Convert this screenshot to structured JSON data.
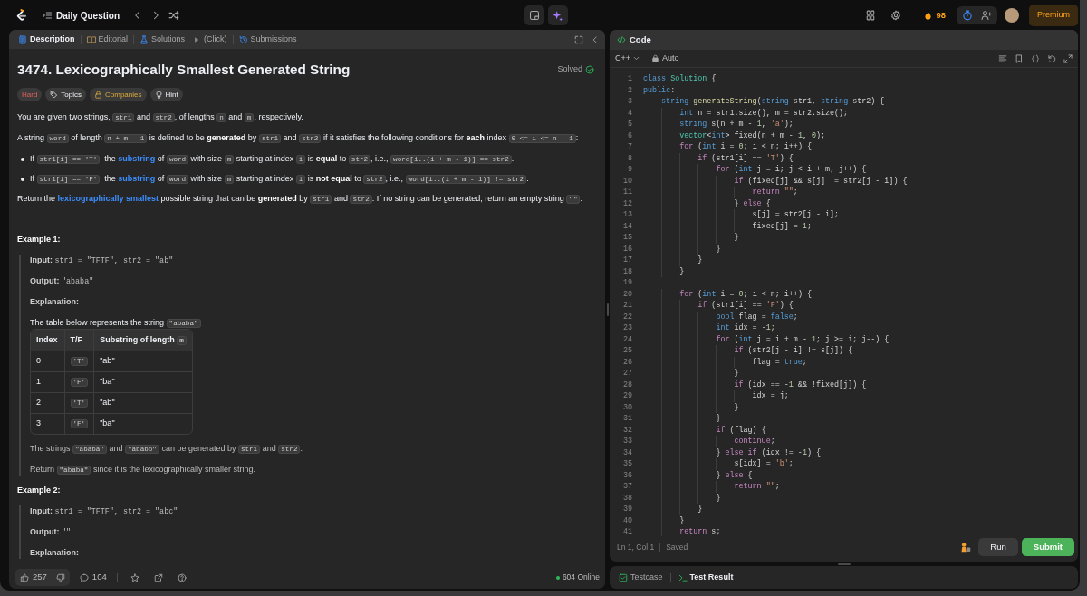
{
  "top_bar": {
    "title": "Daily Question",
    "streak": "98",
    "premium": "Premium"
  },
  "description_panel": {
    "tabs": [
      {
        "label": "Description",
        "selected": true
      },
      {
        "label": "Editorial",
        "selected": false
      },
      {
        "label": "Solutions",
        "selected": false
      },
      {
        "label": "(Click)",
        "selected": false
      },
      {
        "label": "Submissions",
        "selected": false
      }
    ],
    "title": "3474. Lexicographically Smallest Generated String",
    "status": "Solved",
    "tags": [
      {
        "label": "Hard",
        "kind": "difficulty"
      },
      {
        "label": "Topics",
        "kind": "topics"
      },
      {
        "label": "Companies",
        "kind": "companies"
      },
      {
        "label": "Hint",
        "kind": "hint"
      }
    ],
    "statement": [
      {
        "kind": "paragraph",
        "segments": [
          {
            "text": "You are given two strings, "
          },
          {
            "code": "str1"
          },
          {
            "text": " and "
          },
          {
            "code": "str2"
          },
          {
            "text": ", of lengths "
          },
          {
            "code": "n"
          },
          {
            "text": " and "
          },
          {
            "code": "m"
          },
          {
            "text": ", respectively."
          }
        ]
      },
      {
        "kind": "paragraph",
        "segments": [
          {
            "text": "A string "
          },
          {
            "code": "word"
          },
          {
            "text": " of length "
          },
          {
            "code": "n + m - 1"
          },
          {
            "text": " is defined to be **generated** by "
          },
          {
            "code": "str1"
          },
          {
            "text": " and "
          },
          {
            "code": "str2"
          },
          {
            "text": " if it satisfies the following conditions for **each** index "
          },
          {
            "code": "0 <= i <= n - 1"
          },
          {
            "text": ":"
          }
        ]
      },
      {
        "kind": "bullet",
        "segments": [
          {
            "text": "If "
          },
          {
            "code": "str1[i] == 'T'"
          },
          {
            "text": ", the "
          },
          {
            "link": "substring"
          },
          {
            "text": " of "
          },
          {
            "code": "word"
          },
          {
            "text": " with size "
          },
          {
            "code": "m"
          },
          {
            "text": " starting at index "
          },
          {
            "code": "i"
          },
          {
            "text": " is **equal** to "
          },
          {
            "code": "str2"
          },
          {
            "text": ", i.e., "
          },
          {
            "code": "word[i..(i + m - 1)] == str2"
          },
          {
            "text": "."
          }
        ]
      },
      {
        "kind": "bullet",
        "segments": [
          {
            "text": "If "
          },
          {
            "code": "str1[i] == 'F'"
          },
          {
            "text": ", the "
          },
          {
            "link": "substring"
          },
          {
            "text": " of "
          },
          {
            "code": "word"
          },
          {
            "text": " with size "
          },
          {
            "code": "m"
          },
          {
            "text": " starting at index "
          },
          {
            "code": "i"
          },
          {
            "text": " is **not equal** to "
          },
          {
            "code": "str2"
          },
          {
            "text": ", i.e., "
          },
          {
            "code": "word[i..(i + m - 1)] != str2"
          },
          {
            "text": "."
          }
        ]
      },
      {
        "kind": "paragraph",
        "segments": [
          {
            "text": "Return the "
          },
          {
            "link": "lexicographically smallest"
          },
          {
            "text": " possible string that can be **generated** by "
          },
          {
            "code": "str1"
          },
          {
            "text": " and "
          },
          {
            "code": "str2"
          },
          {
            "text": ". If no string can be generated, return an empty string "
          },
          {
            "code": "\"\""
          },
          {
            "text": "."
          }
        ]
      }
    ],
    "examples": [
      {
        "heading": "Example 1:",
        "items": [
          {
            "kind": "io",
            "label": "Input:",
            "value": "str1 = \"TFTF\", str2 = \"ab\""
          },
          {
            "kind": "io",
            "label": "Output:",
            "value": "\"ababa\""
          },
          {
            "kind": "label",
            "label": "Explanation:"
          },
          {
            "kind": "paragraph",
            "segments": [
              {
                "text": "The table below represents the string "
              },
              {
                "code": "\"ababa\""
              }
            ]
          },
          {
            "kind": "table",
            "columns": [
              {
                "segments": [
                  {
                    "text": "Index"
                  }
                ],
                "kind": "text"
              },
              {
                "segments": [
                  {
                    "text": "T/F"
                  }
                ],
                "kind": "code"
              },
              {
                "segments": [
                  {
                    "text": "Substring of length "
                  },
                  {
                    "code": "m"
                  }
                ],
                "kind": "text"
              }
            ],
            "rows": [
              [
                "0",
                "'T'",
                "\"ab\""
              ],
              [
                "1",
                "'F'",
                "\"ba\""
              ],
              [
                "2",
                "'T'",
                "\"ab\""
              ],
              [
                "3",
                "'F'",
                "\"ba\""
              ]
            ]
          },
          {
            "kind": "note",
            "segments": [
              {
                "text": "The strings "
              },
              {
                "code": "\"ababa\""
              },
              {
                "text": " and "
              },
              {
                "code": "\"ababb\""
              },
              {
                "text": " can be generated by "
              },
              {
                "code": "str1"
              },
              {
                "text": " and "
              },
              {
                "code": "str2"
              },
              {
                "text": "."
              }
            ]
          },
          {
            "kind": "note",
            "segments": [
              {
                "text": "Return "
              },
              {
                "code": "\"ababa\""
              },
              {
                "text": " since it is the lexicographically smaller string."
              }
            ]
          }
        ]
      },
      {
        "heading": "Example 2:",
        "items": [
          {
            "kind": "io",
            "label": "Input:",
            "value": "str1 = \"TFTF\", str2 = \"abc\""
          },
          {
            "kind": "io",
            "label": "Output:",
            "value": "\"\""
          },
          {
            "kind": "label",
            "label": "Explanation:"
          }
        ]
      }
    ],
    "footer": {
      "likes": "257",
      "comments": "104",
      "online": "604 Online"
    }
  },
  "editor": {
    "title": "Code",
    "language": "C++",
    "mode": "Auto",
    "lines": [
      {
        "number": "1",
        "tokens": [
          {
            "kind": "keyword",
            "text": "class"
          },
          {
            "kind": "type",
            "text": " Solution"
          },
          {
            "kind": "plain",
            "text": " {"
          }
        ]
      },
      {
        "number": "2",
        "tokens": [
          {
            "kind": "keyword",
            "text": "public"
          },
          {
            "kind": "plain",
            "text": ":"
          }
        ]
      },
      {
        "number": "3",
        "tokens": [
          {
            "kind": "keyword",
            "text": "    string"
          },
          {
            "kind": "function",
            "text": " generateString"
          },
          {
            "kind": "plain",
            "text": "("
          },
          {
            "kind": "keyword",
            "text": "string"
          },
          {
            "kind": "plain",
            "text": " str1, "
          },
          {
            "kind": "keyword",
            "text": "string"
          },
          {
            "kind": "plain",
            "text": " str2) {"
          }
        ]
      },
      {
        "number": "4",
        "tokens": [
          {
            "kind": "keyword",
            "text": "        int"
          },
          {
            "kind": "plain",
            "text": " n = str1.size(), m = str2.size();"
          }
        ]
      },
      {
        "number": "5",
        "tokens": [
          {
            "kind": "keyword",
            "text": "        string"
          },
          {
            "kind": "plain",
            "text": " s(n + m - "
          },
          {
            "kind": "number",
            "text": "1"
          },
          {
            "kind": "plain",
            "text": ", "
          },
          {
            "kind": "string",
            "text": "'a'"
          },
          {
            "kind": "plain",
            "text": ");"
          }
        ]
      },
      {
        "number": "6",
        "tokens": [
          {
            "kind": "type",
            "text": "        vector"
          },
          {
            "kind": "plain",
            "text": "<"
          },
          {
            "kind": "keyword",
            "text": "int"
          },
          {
            "kind": "plain",
            "text": "> fixed(n + m - "
          },
          {
            "kind": "number",
            "text": "1"
          },
          {
            "kind": "plain",
            "text": ", "
          },
          {
            "kind": "number",
            "text": "0"
          },
          {
            "kind": "plain",
            "text": ");"
          }
        ]
      },
      {
        "number": "7",
        "tokens": [
          {
            "kind": "control",
            "text": "        for"
          },
          {
            "kind": "plain",
            "text": " ("
          },
          {
            "kind": "keyword",
            "text": "int"
          },
          {
            "kind": "plain",
            "text": " i = "
          },
          {
            "kind": "number",
            "text": "0"
          },
          {
            "kind": "plain",
            "text": "; i < n; i++) {"
          }
        ]
      },
      {
        "number": "8",
        "tokens": [
          {
            "kind": "control",
            "text": "            if"
          },
          {
            "kind": "plain",
            "text": " (str1[i] == "
          },
          {
            "kind": "string",
            "text": "'T'"
          },
          {
            "kind": "plain",
            "text": ") {"
          }
        ]
      },
      {
        "number": "9",
        "tokens": [
          {
            "kind": "control",
            "text": "                for"
          },
          {
            "kind": "plain",
            "text": " ("
          },
          {
            "kind": "keyword",
            "text": "int"
          },
          {
            "kind": "plain",
            "text": " j = i; j < i + m; j++) {"
          }
        ]
      },
      {
        "number": "10",
        "tokens": [
          {
            "kind": "control",
            "text": "                    if"
          },
          {
            "kind": "plain",
            "text": " (fixed[j] && s[j] != str2[j - i]) {"
          }
        ]
      },
      {
        "number": "11",
        "tokens": [
          {
            "kind": "control",
            "text": "                        return"
          },
          {
            "kind": "string",
            "text": " \"\""
          },
          {
            "kind": "plain",
            "text": ";"
          }
        ]
      },
      {
        "number": "12",
        "tokens": [
          {
            "kind": "plain",
            "text": "                    } "
          },
          {
            "kind": "control",
            "text": "else"
          },
          {
            "kind": "plain",
            "text": " {"
          }
        ]
      },
      {
        "number": "13",
        "tokens": [
          {
            "kind": "plain",
            "text": "                        s[j] = str2[j - i];"
          }
        ]
      },
      {
        "number": "14",
        "tokens": [
          {
            "kind": "plain",
            "text": "                        fixed[j] = "
          },
          {
            "kind": "number",
            "text": "1"
          },
          {
            "kind": "plain",
            "text": ";"
          }
        ]
      },
      {
        "number": "15",
        "tokens": [
          {
            "kind": "plain",
            "text": "                    }"
          }
        ]
      },
      {
        "number": "16",
        "tokens": [
          {
            "kind": "plain",
            "text": "                }"
          }
        ]
      },
      {
        "number": "17",
        "tokens": [
          {
            "kind": "plain",
            "text": "            }"
          }
        ]
      },
      {
        "number": "18",
        "tokens": [
          {
            "kind": "plain",
            "text": "        }"
          }
        ]
      },
      {
        "number": "19"
      },
      {
        "number": "20",
        "tokens": [
          {
            "kind": "control",
            "text": "        for"
          },
          {
            "kind": "plain",
            "text": " ("
          },
          {
            "kind": "keyword",
            "text": "int"
          },
          {
            "kind": "plain",
            "text": " i = "
          },
          {
            "kind": "number",
            "text": "0"
          },
          {
            "kind": "plain",
            "text": "; i < n; i++) {"
          }
        ]
      },
      {
        "number": "21",
        "tokens": [
          {
            "kind": "control",
            "text": "            if"
          },
          {
            "kind": "plain",
            "text": " (str1[i] == "
          },
          {
            "kind": "string",
            "text": "'F'"
          },
          {
            "kind": "plain",
            "text": ") {"
          }
        ]
      },
      {
        "number": "22",
        "tokens": [
          {
            "kind": "keyword",
            "text": "                bool"
          },
          {
            "kind": "plain",
            "text": " flag = "
          },
          {
            "kind": "keyword",
            "text": "false"
          },
          {
            "kind": "plain",
            "text": ";"
          }
        ]
      },
      {
        "number": "23",
        "tokens": [
          {
            "kind": "keyword",
            "text": "                int"
          },
          {
            "kind": "plain",
            "text": " idx = -"
          },
          {
            "kind": "number",
            "text": "1"
          },
          {
            "kind": "plain",
            "text": ";"
          }
        ]
      },
      {
        "number": "24",
        "tokens": [
          {
            "kind": "control",
            "text": "                for"
          },
          {
            "kind": "plain",
            "text": " ("
          },
          {
            "kind": "keyword",
            "text": "int"
          },
          {
            "kind": "plain",
            "text": " j = i + m - "
          },
          {
            "kind": "number",
            "text": "1"
          },
          {
            "kind": "plain",
            "text": "; j >= i; j--) {"
          }
        ]
      },
      {
        "number": "25",
        "tokens": [
          {
            "kind": "control",
            "text": "                    if"
          },
          {
            "kind": "plain",
            "text": " (str2[j - i] != s[j]) {"
          }
        ]
      },
      {
        "number": "26",
        "tokens": [
          {
            "kind": "plain",
            "text": "                        flag = "
          },
          {
            "kind": "keyword",
            "text": "true"
          },
          {
            "kind": "plain",
            "text": ";"
          }
        ]
      },
      {
        "number": "27",
        "tokens": [
          {
            "kind": "plain",
            "text": "                    }"
          }
        ]
      },
      {
        "number": "28",
        "tokens": [
          {
            "kind": "control",
            "text": "                    if"
          },
          {
            "kind": "plain",
            "text": " (idx == -"
          },
          {
            "kind": "number",
            "text": "1"
          },
          {
            "kind": "plain",
            "text": " && !fixed[j]) {"
          }
        ]
      },
      {
        "number": "29",
        "tokens": [
          {
            "kind": "plain",
            "text": "                        idx = j;"
          }
        ]
      },
      {
        "number": "30",
        "tokens": [
          {
            "kind": "plain",
            "text": "                    }"
          }
        ]
      },
      {
        "number": "31",
        "tokens": [
          {
            "kind": "plain",
            "text": "                }"
          }
        ]
      },
      {
        "number": "32",
        "tokens": [
          {
            "kind": "control",
            "text": "                if"
          },
          {
            "kind": "plain",
            "text": " (flag) {"
          }
        ]
      },
      {
        "number": "33",
        "tokens": [
          {
            "kind": "control",
            "text": "                    continue"
          },
          {
            "kind": "plain",
            "text": ";"
          }
        ]
      },
      {
        "number": "34",
        "tokens": [
          {
            "kind": "plain",
            "text": "                } "
          },
          {
            "kind": "control",
            "text": "else"
          },
          {
            "kind": "control",
            "text": " if"
          },
          {
            "kind": "plain",
            "text": " (idx != -"
          },
          {
            "kind": "number",
            "text": "1"
          },
          {
            "kind": "plain",
            "text": ") {"
          }
        ]
      },
      {
        "number": "35",
        "tokens": [
          {
            "kind": "plain",
            "text": "                    s[idx] = "
          },
          {
            "kind": "string",
            "text": "'b'"
          },
          {
            "kind": "plain",
            "text": ";"
          }
        ]
      },
      {
        "number": "36",
        "tokens": [
          {
            "kind": "plain",
            "text": "                } "
          },
          {
            "kind": "control",
            "text": "else"
          },
          {
            "kind": "plain",
            "text": " {"
          }
        ]
      },
      {
        "number": "37",
        "tokens": [
          {
            "kind": "control",
            "text": "                    return"
          },
          {
            "kind": "string",
            "text": " \"\""
          },
          {
            "kind": "plain",
            "text": ";"
          }
        ]
      },
      {
        "number": "38",
        "tokens": [
          {
            "kind": "plain",
            "text": "                }"
          }
        ]
      },
      {
        "number": "39",
        "tokens": [
          {
            "kind": "plain",
            "text": "            }"
          }
        ]
      },
      {
        "number": "40",
        "tokens": [
          {
            "kind": "plain",
            "text": "        }"
          }
        ]
      },
      {
        "number": "41",
        "tokens": [
          {
            "kind": "control",
            "text": "        return"
          },
          {
            "kind": "plain",
            "text": " s;"
          }
        ]
      }
    ],
    "cursor": "Ln 1, Col 1",
    "save_state": "Saved",
    "run": "Run",
    "submit": "Submit"
  },
  "console": {
    "tabs": [
      {
        "label": "Testcase",
        "selected": false
      },
      {
        "label": "Test Result",
        "selected": true
      }
    ]
  }
}
